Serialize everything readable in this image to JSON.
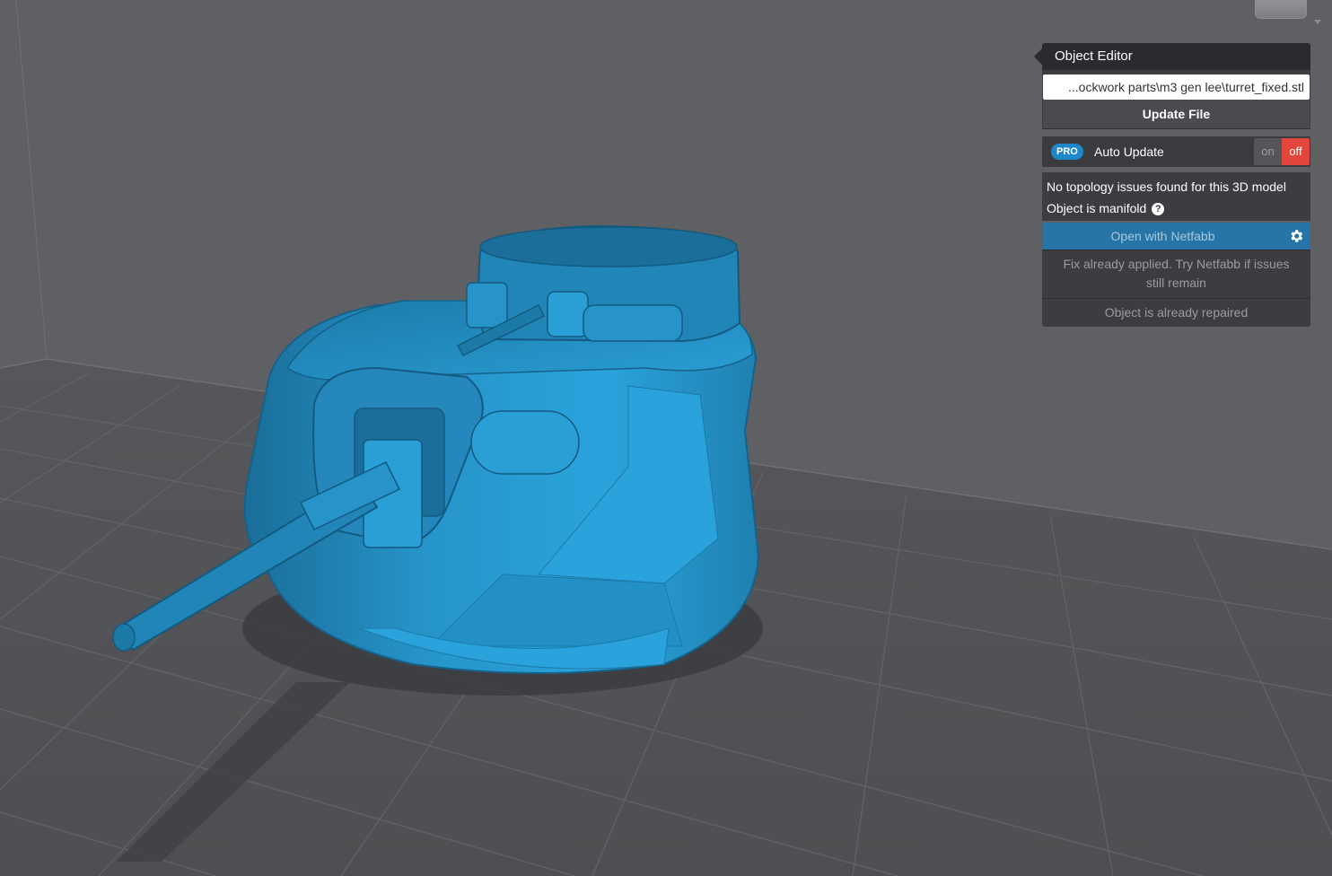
{
  "editor": {
    "title": "Object Editor",
    "file_path": "...ockwork parts\\m3 gen lee\\turret_fixed.stl",
    "update_label": "Update File",
    "pro_badge": "PRO",
    "auto_update_label": "Auto Update",
    "toggle_on": "on",
    "toggle_off": "off",
    "auto_update_state": "off",
    "topology_message": "No topology issues found for this 3D model",
    "manifold_message": "Object is manifold",
    "help_symbol": "?",
    "netfabb_label": "Open with Netfabb",
    "fix_applied_message": "Fix already applied. Try Netfabb if issues still remain",
    "repaired_message": "Object is already repaired"
  },
  "icons": {
    "gear": "gear-icon",
    "help": "help-icon",
    "view_cube": "view-cube-icon"
  },
  "colors": {
    "model": "#2a9fd6",
    "background": "#5f6063",
    "accent": "#2675a6",
    "pro_badge": "#1f86c9",
    "toggle_off": "#e3463d"
  }
}
